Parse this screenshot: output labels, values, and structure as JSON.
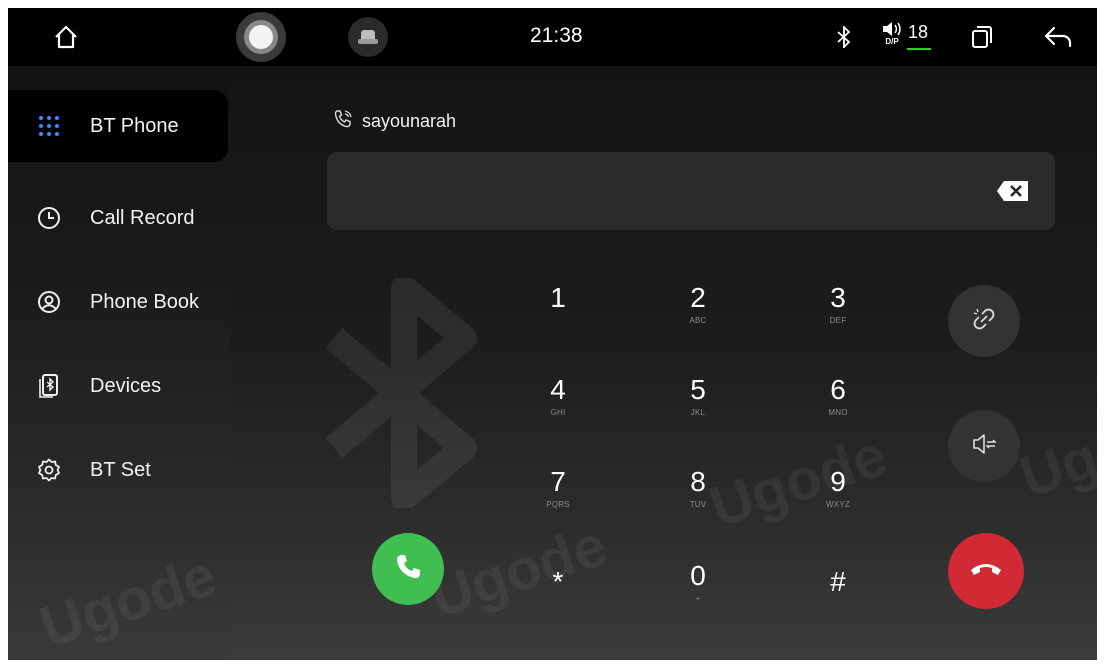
{
  "status_bar": {
    "time": "21:38",
    "volume_level": "18",
    "volume_mode": "D/P"
  },
  "sidebar": {
    "items": [
      {
        "label": "BT Phone",
        "icon": "dialpad-icon",
        "active": true
      },
      {
        "label": "Call Record",
        "icon": "clock-icon",
        "active": false
      },
      {
        "label": "Phone Book",
        "icon": "contact-icon",
        "active": false
      },
      {
        "label": "Devices",
        "icon": "bluetooth-device-icon",
        "active": false
      },
      {
        "label": "BT Set",
        "icon": "gear-icon",
        "active": false
      }
    ]
  },
  "contact": {
    "name": "sayounarah"
  },
  "dial_input": {
    "value": ""
  },
  "keypad": [
    {
      "digit": "1",
      "letters": ""
    },
    {
      "digit": "2",
      "letters": "ABC"
    },
    {
      "digit": "3",
      "letters": "DEF"
    },
    {
      "digit": "4",
      "letters": "GHI"
    },
    {
      "digit": "5",
      "letters": "JKL"
    },
    {
      "digit": "6",
      "letters": "MNO"
    },
    {
      "digit": "7",
      "letters": "PQRS"
    },
    {
      "digit": "8",
      "letters": "TUV"
    },
    {
      "digit": "9",
      "letters": "WXYZ"
    },
    {
      "digit": "*",
      "letters": ""
    },
    {
      "digit": "0",
      "letters": "+"
    },
    {
      "digit": "#",
      "letters": ""
    }
  ],
  "watermark": "Ugode",
  "colors": {
    "call": "#3fbf4f",
    "hangup": "#d12a35",
    "dialpad_accent": "#2f8fff",
    "volume_indicator": "#2bd12b"
  }
}
